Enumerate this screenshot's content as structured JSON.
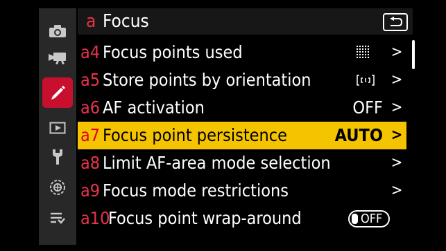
{
  "header": {
    "letter": "a",
    "title": "Focus"
  },
  "sidebar": {
    "items": [
      {
        "icon": "camera-icon"
      },
      {
        "icon": "movie-camera-icon"
      },
      {
        "icon": "pencil-icon",
        "active": true
      },
      {
        "icon": "playback-icon"
      },
      {
        "icon": "wrench-icon"
      },
      {
        "icon": "network-icon"
      },
      {
        "icon": "my-menu-icon"
      }
    ]
  },
  "menu": {
    "items": [
      {
        "code": "a4",
        "label": "Focus points used",
        "icon": "focus-points-grid-icon"
      },
      {
        "code": "a5",
        "label": "Store points by orientation",
        "icon": "orientation-icon"
      },
      {
        "code": "a6",
        "label": "AF activation",
        "value": "OFF"
      },
      {
        "code": "a7",
        "label": "Focus point persistence",
        "value": "AUTO",
        "selected": true
      },
      {
        "code": "a8",
        "label": "Limit AF-area mode selection"
      },
      {
        "code": "a9",
        "label": "Focus mode restrictions"
      },
      {
        "code": "a10",
        "label": "Focus point wrap-around",
        "toggle": "OFF"
      }
    ],
    "chevron": ">"
  },
  "colors": {
    "accent_red": "#e8334a",
    "highlight": "#f5c400",
    "sidebar_active": "#c8102e"
  }
}
